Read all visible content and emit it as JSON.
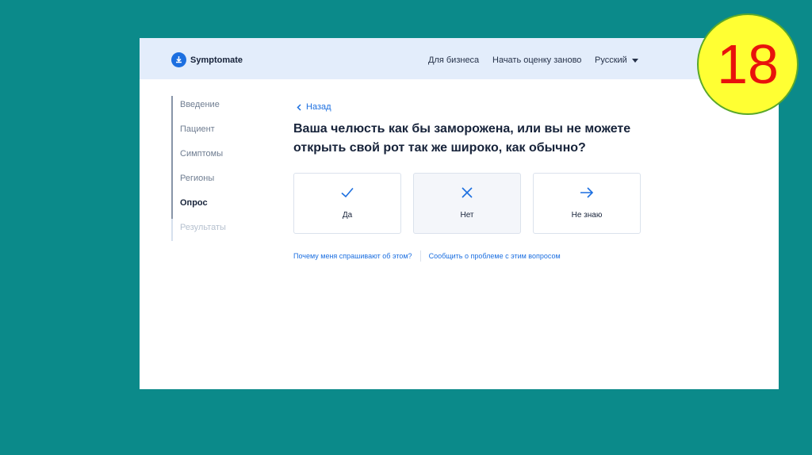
{
  "header": {
    "brand": "Symptomate",
    "nav": {
      "business": "Для бизнеса",
      "restart": "Начать оценку заново",
      "language": "Русский"
    }
  },
  "sidebar": {
    "items": [
      {
        "label": "Введение",
        "state": "done"
      },
      {
        "label": "Пациент",
        "state": "done"
      },
      {
        "label": "Симптомы",
        "state": "done"
      },
      {
        "label": "Регионы",
        "state": "done"
      },
      {
        "label": "Опрос",
        "state": "active"
      },
      {
        "label": "Результаты",
        "state": "disabled"
      }
    ]
  },
  "main": {
    "back_label": "Назад",
    "question": "Ваша челюсть как бы заморожена, или вы не можете открыть свой рот так же широко, как обычно?",
    "answers": [
      {
        "label": "Да",
        "icon": "check-icon"
      },
      {
        "label": "Нет",
        "icon": "cross-icon"
      },
      {
        "label": "Не знаю",
        "icon": "arrow-right-icon"
      }
    ],
    "links": {
      "why": "Почему меня спрашивают об этом?",
      "report": "Сообщить о проблеме с этим вопросом"
    }
  },
  "slide_number": "18",
  "colors": {
    "accent": "#1c6fe0",
    "background": "#0b8a8a",
    "header_bg": "#e3edfb",
    "badge": "#ffff33",
    "badge_text": "#e8120c"
  }
}
